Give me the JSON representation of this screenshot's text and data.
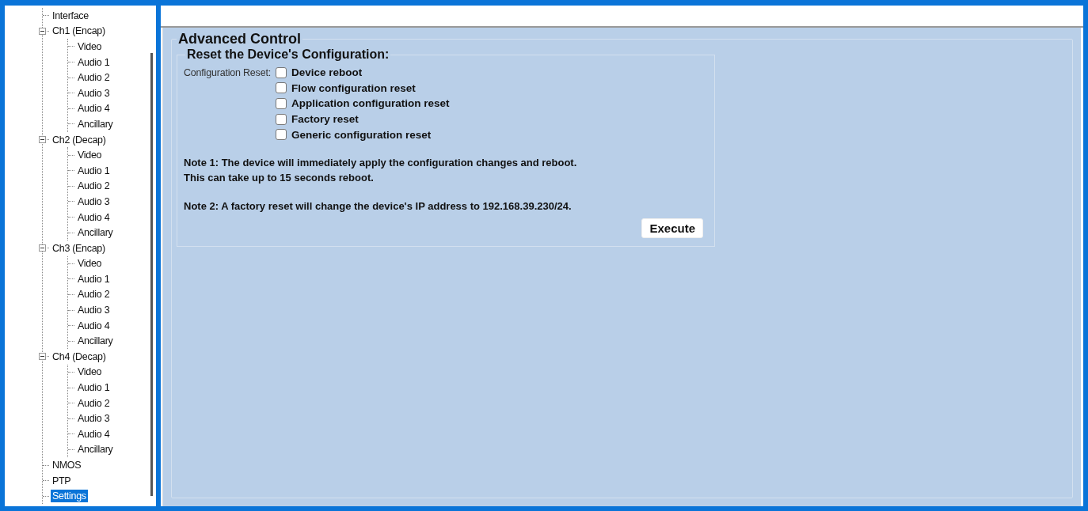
{
  "tree": [
    {
      "label": "Interface",
      "selected": false
    },
    {
      "label": "Ch1 (Encap)",
      "selected": false,
      "expanded": true,
      "children": [
        {
          "label": "Video",
          "selected": false
        },
        {
          "label": "Audio 1",
          "selected": false
        },
        {
          "label": "Audio 2",
          "selected": false
        },
        {
          "label": "Audio 3",
          "selected": false
        },
        {
          "label": "Audio 4",
          "selected": false
        },
        {
          "label": "Ancillary",
          "selected": false
        }
      ]
    },
    {
      "label": "Ch2 (Decap)",
      "selected": false,
      "expanded": true,
      "children": [
        {
          "label": "Video",
          "selected": false
        },
        {
          "label": "Audio 1",
          "selected": false
        },
        {
          "label": "Audio 2",
          "selected": false
        },
        {
          "label": "Audio 3",
          "selected": false
        },
        {
          "label": "Audio 4",
          "selected": false
        },
        {
          "label": "Ancillary",
          "selected": false
        }
      ]
    },
    {
      "label": "Ch3 (Encap)",
      "selected": false,
      "expanded": true,
      "children": [
        {
          "label": "Video",
          "selected": false
        },
        {
          "label": "Audio 1",
          "selected": false
        },
        {
          "label": "Audio 2",
          "selected": false
        },
        {
          "label": "Audio 3",
          "selected": false
        },
        {
          "label": "Audio 4",
          "selected": false
        },
        {
          "label": "Ancillary",
          "selected": false
        }
      ]
    },
    {
      "label": "Ch4 (Decap)",
      "selected": false,
      "expanded": true,
      "children": [
        {
          "label": "Video",
          "selected": false
        },
        {
          "label": "Audio 1",
          "selected": false
        },
        {
          "label": "Audio 2",
          "selected": false
        },
        {
          "label": "Audio 3",
          "selected": false
        },
        {
          "label": "Audio 4",
          "selected": false
        },
        {
          "label": "Ancillary",
          "selected": false
        }
      ]
    },
    {
      "label": "NMOS",
      "selected": false
    },
    {
      "label": "PTP",
      "selected": false
    },
    {
      "label": "Settings",
      "selected": true
    }
  ],
  "panel": {
    "title": "Advanced Control",
    "group": {
      "title": "Reset the Device's Configuration:",
      "field_label": "Configuration Reset:",
      "options": [
        {
          "label": "Device reboot",
          "checked": false
        },
        {
          "label": "Flow configuration reset",
          "checked": false
        },
        {
          "label": "Application configuration reset",
          "checked": false
        },
        {
          "label": "Factory reset",
          "checked": false
        },
        {
          "label": "Generic configuration reset",
          "checked": false
        }
      ],
      "notes": [
        "Note 1: The device will immediately apply the configuration changes and reboot.\nThis can take up to 15 seconds reboot.",
        "Note 2: A factory reset will change the device's IP address to 192.168.39.230/24."
      ],
      "button": "Execute"
    }
  }
}
